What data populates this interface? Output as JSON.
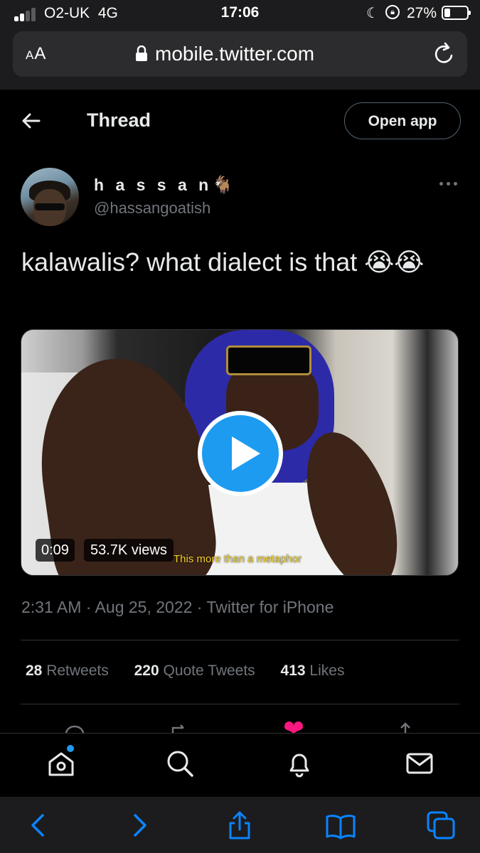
{
  "status_bar": {
    "carrier": "O2-UK",
    "network": "4G",
    "time": "17:06",
    "battery_percent": "27%",
    "battery_level": 0.27,
    "icons": [
      "signal-icon",
      "moon-icon",
      "orientation-lock-icon",
      "battery-icon"
    ]
  },
  "browser": {
    "text_size_label": "AA",
    "url": "mobile.twitter.com",
    "icons": [
      "padlock-icon",
      "reload-icon"
    ]
  },
  "header": {
    "title": "Thread",
    "open_app_label": "Open app"
  },
  "tweet": {
    "display_name": "h a s s a n",
    "name_emoji": "🐐",
    "handle": "@hassangoatish",
    "text": "kalawalis? what dialect is that 😭😭",
    "video": {
      "duration": "0:09",
      "views": "53.7K views",
      "caption": "This more than a metaphor"
    },
    "meta": "2:31 AM · Aug 25, 2022 · Twitter for iPhone",
    "stats": [
      {
        "count": "28",
        "label": "Retweets"
      },
      {
        "count": "220",
        "label": "Quote Tweets"
      },
      {
        "count": "413",
        "label": "Likes"
      }
    ]
  },
  "bottom_nav": {
    "items": [
      "home-icon",
      "search-icon",
      "notifications-icon",
      "messages-icon"
    ],
    "accent": "#1d9bf0"
  },
  "safari_toolbar": {
    "items": [
      "back-icon",
      "forward-icon",
      "share-icon",
      "bookmarks-icon",
      "tabs-icon"
    ],
    "accent": "#0a84ff"
  },
  "colors": {
    "background": "#000000",
    "text": "#e7e9ea",
    "secondary_text": "#71767b",
    "twitter_blue": "#1d9bf0",
    "like_pink": "#f91880"
  }
}
